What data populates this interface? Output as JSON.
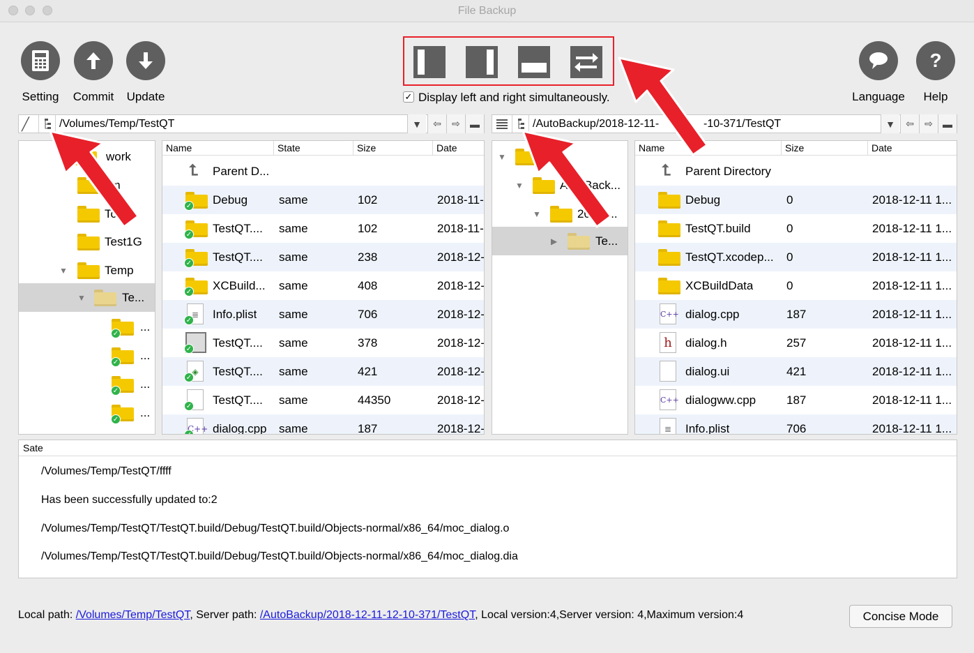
{
  "window": {
    "title": "File Backup"
  },
  "toolbar": {
    "setting": {
      "label": "Setting",
      "icon": "calculator-icon"
    },
    "commit": {
      "label": "Commit",
      "icon": "arrow-up-icon"
    },
    "update": {
      "label": "Update",
      "icon": "arrow-down-icon"
    },
    "language": {
      "label": "Language",
      "icon": "speech-bubble-icon"
    },
    "help": {
      "label": "Help",
      "icon": "question-icon"
    },
    "display_both": {
      "label": "Display left and right simultaneously.",
      "checked": true
    }
  },
  "left": {
    "path": "/Volumes/Temp/TestQT",
    "tree": [
      {
        "label": "work"
      },
      {
        "label": "vm"
      },
      {
        "label": "Tc"
      },
      {
        "label": "Test1G"
      },
      {
        "label": "Temp"
      },
      {
        "label": "Te..."
      },
      {
        "label": "..."
      },
      {
        "label": "..."
      },
      {
        "label": "..."
      },
      {
        "label": "..."
      }
    ],
    "columns": {
      "name": "Name",
      "state": "State",
      "size": "Size",
      "date": "Date"
    },
    "rows": [
      {
        "name": "Parent D...",
        "state": "",
        "size": "",
        "date": ""
      },
      {
        "name": "Debug",
        "state": "same",
        "size": "102",
        "date": "2018-11-"
      },
      {
        "name": "TestQT....",
        "state": "same",
        "size": "102",
        "date": "2018-11-"
      },
      {
        "name": "TestQT....",
        "state": "same",
        "size": "238",
        "date": "2018-12-"
      },
      {
        "name": "XCBuild...",
        "state": "same",
        "size": "408",
        "date": "2018-12-"
      },
      {
        "name": "Info.plist",
        "state": "same",
        "size": "706",
        "date": "2018-12-"
      },
      {
        "name": "TestQT....",
        "state": "same",
        "size": "378",
        "date": "2018-12-"
      },
      {
        "name": "TestQT....",
        "state": "same",
        "size": "421",
        "date": "2018-12-"
      },
      {
        "name": "TestQT....",
        "state": "same",
        "size": "44350",
        "date": "2018-12-"
      },
      {
        "name": "dialog.cpp",
        "state": "same",
        "size": "187",
        "date": "2018-12-"
      }
    ]
  },
  "right": {
    "path": "/AutoBackup/2018-12-11-12-10-371/TestQT",
    "path_display_a": "/AutoBackup/2018-12-11-",
    "path_display_b": "-10-371/TestQT",
    "tree": [
      {
        "label": ""
      },
      {
        "label": "AutoBack..."
      },
      {
        "label": "2018-..."
      },
      {
        "label": "Te..."
      }
    ],
    "columns": {
      "name": "Name",
      "size": "Size",
      "date": "Date"
    },
    "rows": [
      {
        "name": "Parent Directory",
        "size": "",
        "date": ""
      },
      {
        "name": "Debug",
        "size": "0",
        "date": "2018-12-11 1..."
      },
      {
        "name": "TestQT.build",
        "size": "0",
        "date": "2018-12-11 1..."
      },
      {
        "name": "TestQT.xcodep...",
        "size": "0",
        "date": "2018-12-11 1..."
      },
      {
        "name": "XCBuildData",
        "size": "0",
        "date": "2018-12-11 1..."
      },
      {
        "name": "dialog.cpp",
        "size": "187",
        "date": "2018-12-11 1..."
      },
      {
        "name": "dialog.h",
        "size": "257",
        "date": "2018-12-11 1..."
      },
      {
        "name": "dialog.ui",
        "size": "421",
        "date": "2018-12-11 1..."
      },
      {
        "name": "dialogww.cpp",
        "size": "187",
        "date": "2018-12-11 1..."
      },
      {
        "name": "Info.plist",
        "size": "706",
        "date": "2018-12-11 1..."
      }
    ]
  },
  "state_panel": {
    "header": "Sate",
    "lines": [
      "/Volumes/Temp/TestQT/ffff",
      "Has been successfully updated to:2",
      "/Volumes/Temp/TestQT/TestQT.build/Debug/TestQT.build/Objects-normal/x86_64/moc_dialog.o",
      "/Volumes/Temp/TestQT/TestQT.build/Debug/TestQT.build/Objects-normal/x86_64/moc_dialog.dia"
    ]
  },
  "status": {
    "local_label": "Local path: ",
    "local_path": "/Volumes/Temp/TestQT",
    "server_label": ", Server path: ",
    "server_path": "/AutoBackup/2018-12-11-12-10-371/TestQT",
    "versions": ", Local version:4,Server version: 4,Maximum version:4",
    "concise_button": "Concise Mode"
  },
  "colors": {
    "annotation": "#e8202a",
    "icon_gray": "#5f5f5f",
    "link": "#1a1adf",
    "ok_badge": "#2fb34a",
    "folder": "#f5c900"
  }
}
